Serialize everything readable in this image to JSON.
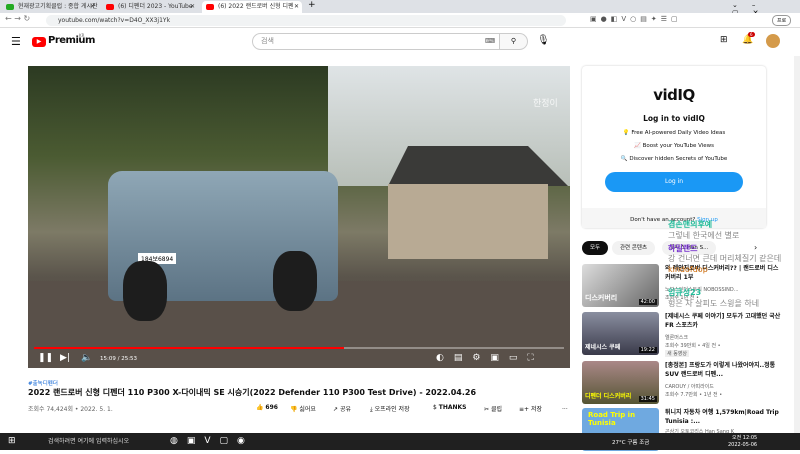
{
  "browser": {
    "tabs": [
      {
        "label": "현재광고기획클럽 : 종합 게시판",
        "active": false
      },
      {
        "label": "(6) 디펜더 2023 - YouTube",
        "active": false
      },
      {
        "label": "(6) 2022 랜드로버 신형 디펜",
        "active": true
      }
    ],
    "url": "youtube.com/watch?v=D4O_XX3j1Yk",
    "profile_label": "프로"
  },
  "youtube": {
    "logo": "Premium",
    "region": "KR",
    "search_placeholder": "검색",
    "notif_count": "6"
  },
  "video": {
    "overlay_text": "한정이",
    "time": "15:09 / 25:53",
    "progress": 0.584,
    "hashtag": "#출녹디펜더",
    "title": "2022 랜드로버 신형 디펜더 110 P300 X-다이내믹 SE 시승기(2022 Defender 110 P300 Test Drive) - 2022.04.26",
    "meta": "조회수 74,424회 • 2022. 5. 1.",
    "plate": "184보6894",
    "actions": {
      "likes": "696",
      "dislike": "싫어요",
      "share": "공유",
      "download": "오프라인 저장",
      "thanks": "THANKS",
      "clip": "클립",
      "save": "저장",
      "more": "..."
    }
  },
  "vidiq": {
    "logo": "vidIQ",
    "heading": "Log in to vidIQ",
    "features": [
      "💡 Free AI-powered Daily Video Ideas",
      "📈 Boost your YouTube Views",
      "🔍 Discover hidden Secrets of YouTube"
    ],
    "login": "Log in",
    "no_account": "Don't have an account?",
    "signup": "Sign up"
  },
  "chips": [
    "모두",
    "관련 콘텐츠",
    "모터스 Han S..."
  ],
  "recommended": [
    {
      "title": "와 레인지로버 디스커버리?? | 랜드로버 디스커버리 1부",
      "channel": "노보스인더스트리 NOBOSSIND...",
      "stats": "조회수 1년 전 •",
      "dur": "42:00",
      "thumb": "디스커버리",
      "color": "#e8e8e8"
    },
    {
      "title": "[제네시스 쿠페 이야기] 모두가 고대했던 국산 FR 스포츠카",
      "channel": "엘론머스크",
      "stats": "조회수 39만회 • 4일 전 •",
      "badge": "새 동영상",
      "dur": "19:22",
      "thumb": "제네시스 쿠페",
      "color": "#557"
    },
    {
      "title": "[총정본] 프랑도가 이렇게 나왔어야지..정통 SUV 랜드로버 디펜...",
      "channel": "CAROUY / 아띠라이드",
      "stats": "조회수 7.7만회 • 1년 전 •",
      "dur": "31:45",
      "thumb": "디펜더 디스커버리",
      "color": "#8a6a4a"
    },
    {
      "title": "튀니지 자동차 여행 1,579km|Road Trip Tunisia :...",
      "channel": "곤상기 오토코리스 Han Sang K",
      "stats": "",
      "dur": "",
      "thumb": "Road Trip in Tunisia",
      "color": "#3a7bd5"
    }
  ],
  "chat_overlay": [
    "겸손맨의후예",
    "그렇네 한국에선 별로",
    "하일랜드",
    "강 건너면 큰데 머리체질기 같은데",
    "kindofdop",
    "임큐성23",
    "헝은 차 살피도 스윙을 하네"
  ],
  "taskbar": {
    "search": "검색하려면 여기에 입력하십시오",
    "weather": "27°C 구름 조금",
    "time": "오전 12:05",
    "date": "2022-05-06"
  }
}
